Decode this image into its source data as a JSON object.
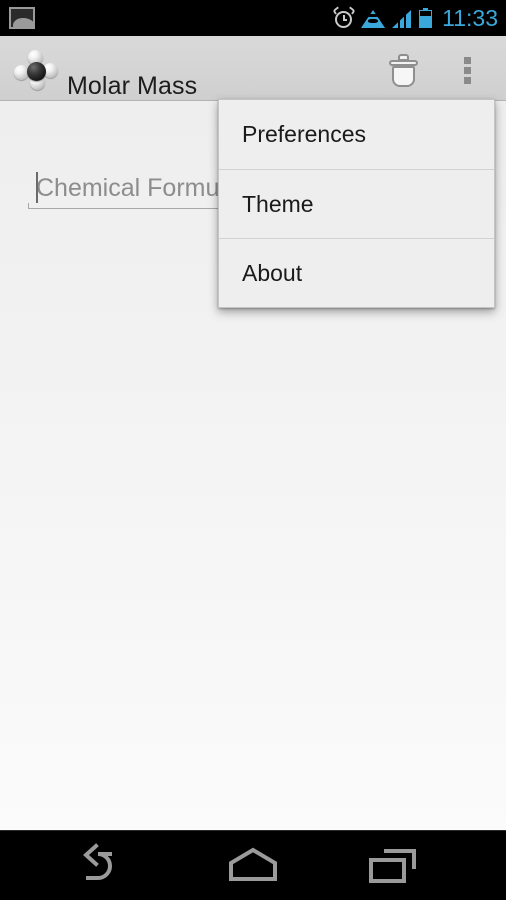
{
  "status_bar": {
    "time": "11:33",
    "icons": [
      {
        "name": "gallery-icon",
        "label": "screenshot"
      },
      {
        "name": "alarm-clock-icon",
        "label": "alarm"
      },
      {
        "name": "wifi-icon",
        "label": "wifi"
      },
      {
        "name": "cellular-signal-icon",
        "label": "signal"
      },
      {
        "name": "battery-icon",
        "label": "battery"
      }
    ],
    "background_color": "#000000",
    "accent_color": "#3ba8db"
  },
  "action_bar": {
    "app_title": "Molar Mass",
    "app_icon": "methane-molecule-icon",
    "delete_label": "Delete",
    "overflow_label": "More options",
    "background_color": "#d4d4d4"
  },
  "input": {
    "placeholder": "Chemical Formula",
    "value": ""
  },
  "overflow_menu": {
    "visible": true,
    "items": [
      {
        "label": "Preferences"
      },
      {
        "label": "Theme"
      },
      {
        "label": "About"
      }
    ]
  },
  "navigation_bar": {
    "back_label": "Back",
    "home_label": "Home",
    "recents_label": "Recent apps"
  }
}
